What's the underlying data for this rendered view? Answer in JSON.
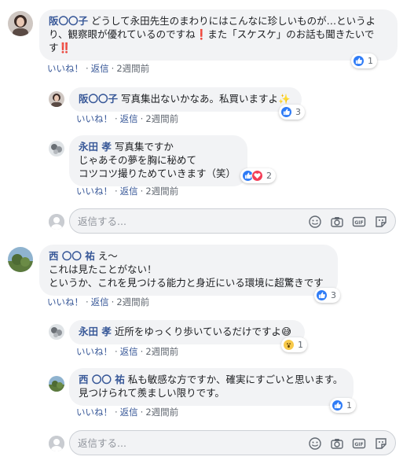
{
  "comments": [
    {
      "author": "阪〇〇子",
      "text": "どうして永田先生のまわりにはこんなに珍しいものが…というより、観察眼が優れているのですね❗また「スケスケ」のお話も聞きたいです‼️",
      "like": "いいね！",
      "reply": "返信",
      "time": "2週間前",
      "reaction_count": "1",
      "replies": [
        {
          "author": "阪〇〇子",
          "text": "写真集出ないかなあ。私買いますよ✨",
          "like": "いいね！",
          "reply": "返信",
          "time": "2週間前",
          "reaction_count": "3"
        },
        {
          "author": "永田 孝",
          "text": "写真集ですか\nじゃあその夢を胸に秘めて\nコツコツ撮りためていきます（笑）",
          "like": "いいね！",
          "reply": "返信",
          "time": "2週間前",
          "reaction_count": "2"
        }
      ],
      "reply_placeholder": "返信する..."
    },
    {
      "author": "西 〇〇 祐",
      "text": "え〜\nこれは見たことがない！\nというか、これを見つける能力と身近にいる環境に超驚きです",
      "like": "いいね！",
      "reply": "返信",
      "time": "2週間前",
      "reaction_count": "3",
      "replies": [
        {
          "author": "永田 孝",
          "text": "近所をゆっくり歩いているだけですよ😅",
          "like": "いいね！",
          "reply": "返信",
          "time": "2週間前",
          "reaction_count": "1"
        },
        {
          "author": "西 〇〇 祐",
          "text": "私も敏感な方ですか、確実にすごいと思います。\n見つけられて羨ましい限りです。",
          "like": "いいね！",
          "reply": "返信",
          "time": "2週間前",
          "reaction_count": "1"
        }
      ],
      "reply_placeholder": "返信する..."
    }
  ],
  "reply_box_icons": [
    "emoji-icon",
    "camera-icon",
    "gif-icon",
    "sticker-icon"
  ],
  "colors": {
    "link": "#385898",
    "like_blue": "#2e7bf6",
    "love_red": "#f33e58",
    "bubble": "#f2f3f5"
  }
}
